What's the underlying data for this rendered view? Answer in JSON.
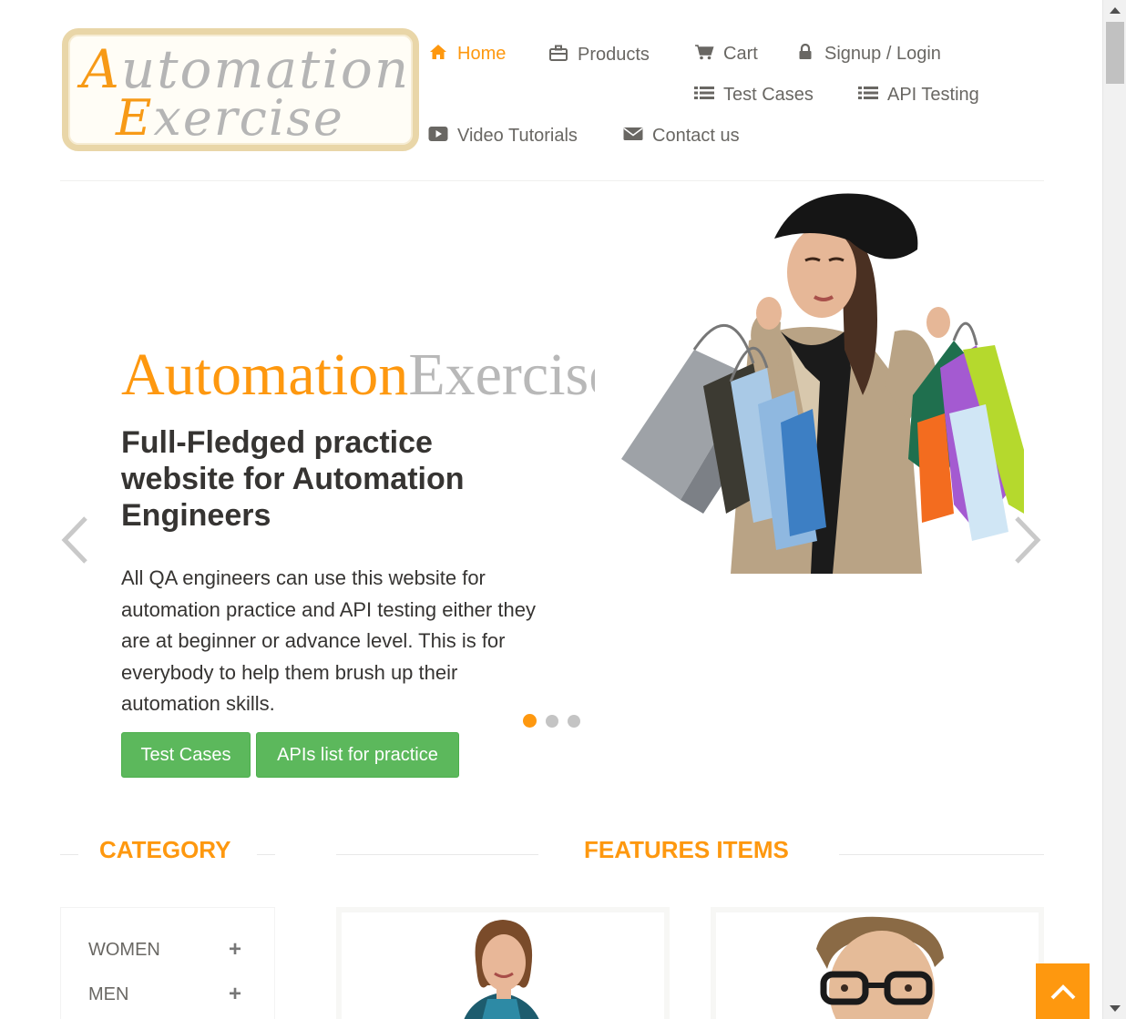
{
  "logo": {
    "line1_hi": "A",
    "line1_rest": "utomation",
    "line2_hi": "E",
    "line2_rest": "xercise"
  },
  "nav": [
    {
      "label": "Home",
      "icon": "home-icon",
      "active": true
    },
    {
      "label": "Products",
      "icon": "briefcase-icon"
    },
    {
      "label": "Cart",
      "icon": "cart-icon"
    },
    {
      "label": "Signup / Login",
      "icon": "lock-icon"
    },
    {
      "label": "Test Cases",
      "icon": "list-icon"
    },
    {
      "label": "API Testing",
      "icon": "list-icon"
    },
    {
      "label": "Video Tutorials",
      "icon": "youtube-play-icon"
    },
    {
      "label": "Contact us",
      "icon": "envelope-icon"
    }
  ],
  "slider": {
    "brand_a": "Automation",
    "brand_b": "Exercise",
    "headline": "Full-Fledged practice website for Automation Engineers",
    "description": "All QA engineers can use this website for automation practice and API testing either they are at beginner or advance level. This is for everybody to help them brush up their automation skills.",
    "btn_test_cases": "Test Cases",
    "btn_apis": "APIs list for practice",
    "active_slide": 1,
    "slide_count": 3
  },
  "sections": {
    "category": "CATEGORY",
    "features": "FEATURES ITEMS"
  },
  "categories": [
    {
      "label": "WOMEN"
    },
    {
      "label": "MEN"
    }
  ],
  "colors": {
    "accent": "#fe980f",
    "button_green": "#5cb85c",
    "text": "#696763"
  }
}
